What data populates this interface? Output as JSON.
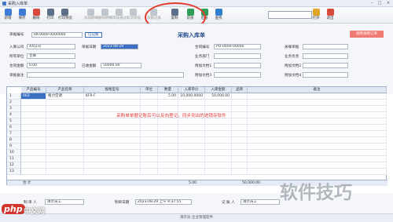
{
  "window": {
    "title": "采购入库单",
    "minimize": "–",
    "maximize": "□",
    "close": "×"
  },
  "toolbar": {
    "buttons": [
      {
        "label": "新增",
        "icon": "new-icon",
        "color": "#3d7bd6",
        "enabled": true
      },
      {
        "label": "保存",
        "icon": "save-icon",
        "color": "#3d7bd6",
        "enabled": true
      },
      {
        "label": "删除",
        "icon": "delete-icon",
        "color": "#d84a3c",
        "enabled": true
      },
      {
        "label": "打印",
        "icon": "print-icon",
        "color": "#5b6f8a",
        "enabled": true
      },
      {
        "label": "打印预览",
        "icon": "preview-icon",
        "color": "#5b6f8a",
        "enabled": true
      },
      {
        "label": "添加明细",
        "icon": "add-row-icon",
        "color": "#7d8a9a",
        "enabled": false
      },
      {
        "label": "删除明细",
        "icon": "remove-row-icon",
        "color": "#7d8a9a",
        "enabled": false
      },
      {
        "label": "审核通过",
        "icon": "approve-icon",
        "color": "#7d8a9a",
        "enabled": false
      },
      {
        "label": "取消审核",
        "icon": "unapprove-icon",
        "color": "#7d8a9a",
        "enabled": false
      },
      {
        "label": "单据记账",
        "icon": "post-icon",
        "color": "#7d8a9a",
        "enabled": false
      },
      {
        "label": "复制",
        "icon": "copy-icon",
        "color": "#5b6f8a",
        "enabled": true
      },
      {
        "label": "前张",
        "icon": "prev-icon",
        "color": "#2e9d57",
        "enabled": true
      },
      {
        "label": "后张",
        "icon": "next-icon",
        "color": "#2e9d57",
        "enabled": true
      },
      {
        "label": "查找",
        "icon": "find-icon",
        "color": "#2e7fd0",
        "enabled": true
      },
      {
        "label": "打开",
        "icon": "open-icon",
        "color": "#e0a526",
        "enabled": true
      },
      {
        "label": "退出",
        "icon": "exit-icon",
        "color": "#d84a3c",
        "enabled": true
      }
    ],
    "search_value": ""
  },
  "form": {
    "title": "采购入库单",
    "badge": "已记账",
    "red_button": "调用采购订单",
    "fields": {
      "doc_no_label": "单据编号",
      "doc_no_value": "RK-0000-0000000",
      "supplier_label": "入库公司",
      "supplier_value": "XX公司",
      "date_label": "单据日期",
      "date_value": "2023-08-29",
      "contract_label": "合同编号",
      "contract_value": "PO-0000-00000",
      "related_label": "关联单据",
      "warehouse_label": "所有单位",
      "warehouse_value": "仓库",
      "dept_label": "业务部门",
      "biz_owner_label": "业务负责",
      "amount_label": "合同金额",
      "amount_value": "0.00",
      "total_label": "已收金额",
      "total_value": "50000.00",
      "attach1_label": "附加文档1",
      "attach2_label": "附加文档2",
      "attach3_label": "附加文档3",
      "attach4_label": "附加文档4",
      "remark_label": "单据备注"
    }
  },
  "grid": {
    "columns": [
      "产品编号",
      "产品名称",
      "规格型号",
      "单位",
      "数量",
      "入库单价",
      "入库金额",
      "品牌",
      "备注"
    ],
    "rows": [
      {
        "num": "1",
        "code": "003",
        "name": "格力空调",
        "spec": "KFR-F",
        "unit": "",
        "qty": "5.00",
        "price": "10,000.0000",
        "amount": "50,000.00",
        "brand": "",
        "note": ""
      },
      {
        "num": "2"
      },
      {
        "num": "3"
      },
      {
        "num": "4"
      },
      {
        "num": "5"
      },
      {
        "num": "6"
      },
      {
        "num": "7"
      },
      {
        "num": "8"
      },
      {
        "num": "9"
      },
      {
        "num": "10"
      },
      {
        "num": "11"
      },
      {
        "num": "12"
      },
      {
        "num": "13"
      }
    ],
    "total_label": "合 计",
    "total_qty": "5.00",
    "total_amount": "50,000.00"
  },
  "annotation": "采购单单据记账后可以反向登记，同步到出的进销存软件",
  "footer": {
    "maker_label": "制 单 人",
    "maker_value": "演示员工",
    "date_label": "制单日期",
    "date_value": "2023-08-29 上午 9:37:55",
    "bookkeeper_label": "记 账 人",
    "bookkeeper_value": "演示员工",
    "status_text": "演示员-企业管理软件"
  },
  "watermark": {
    "logo_text": "php",
    "site_text": "中文网",
    "brand_text": "软件技巧"
  },
  "colors": {
    "accent": "#3a6fc4",
    "annotation": "#e0383a",
    "red_button": "#ef7b74"
  }
}
